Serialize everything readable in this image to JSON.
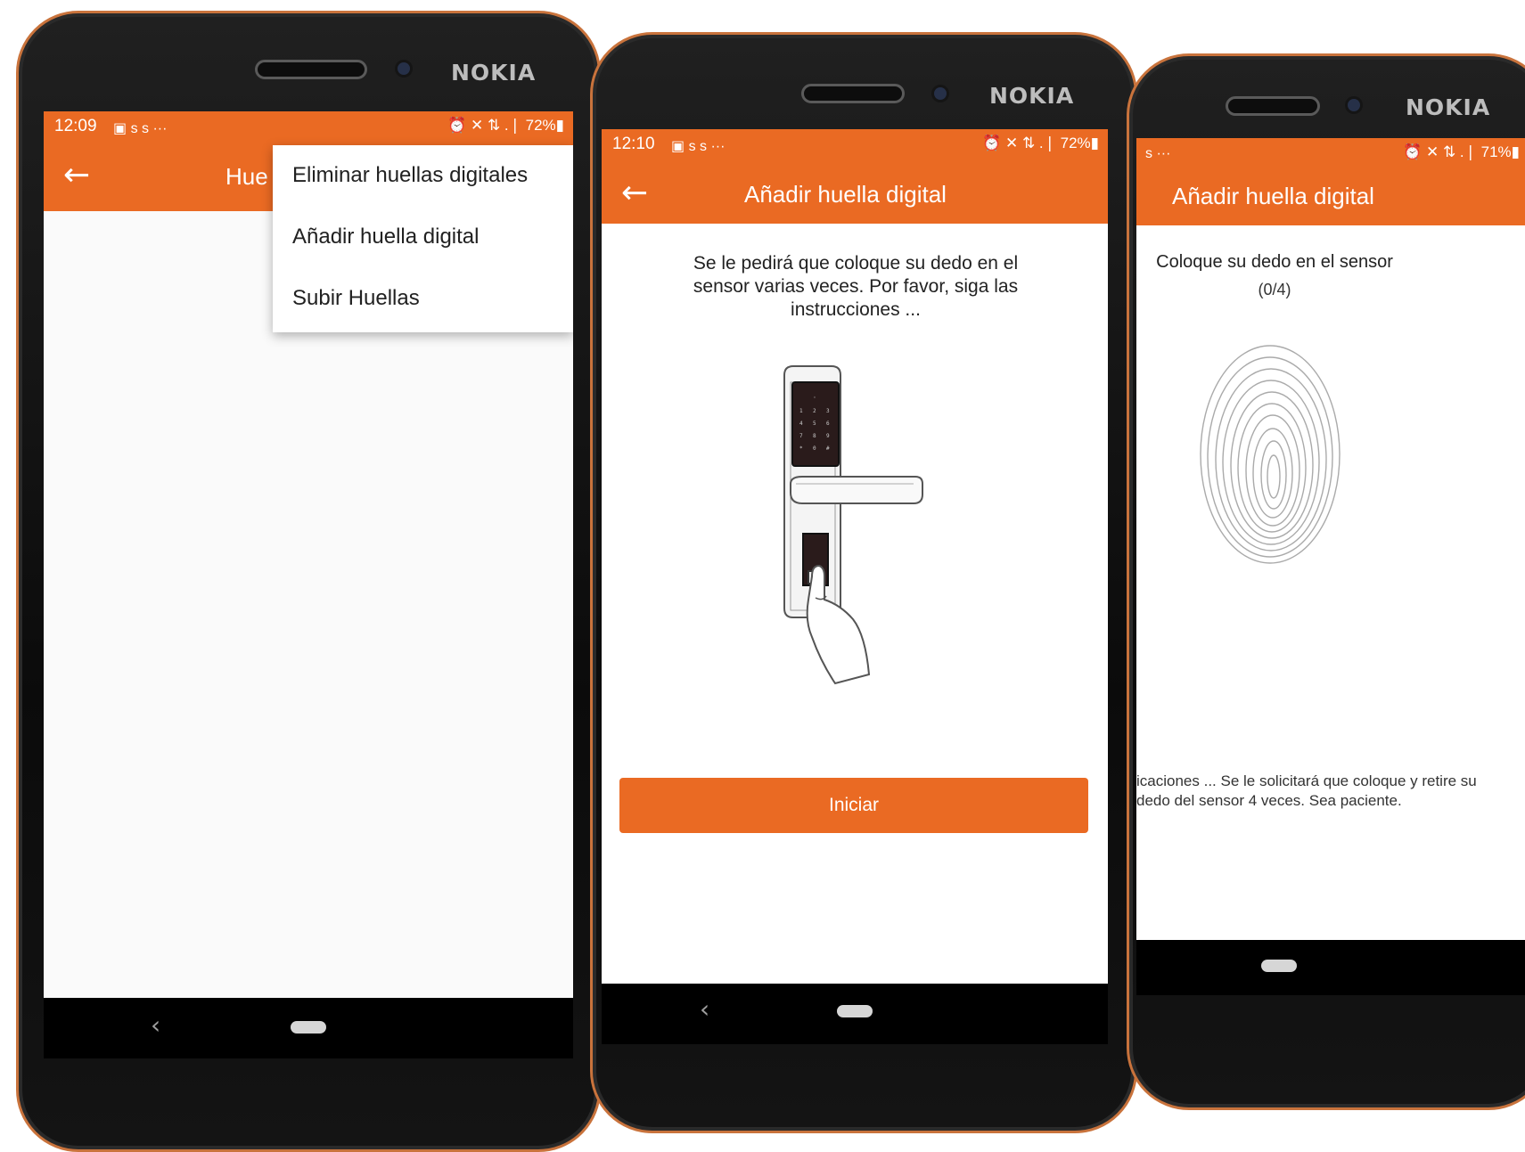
{
  "accent_color": "#ea6a23",
  "phones": {
    "p1": {
      "brand": "NOKIA",
      "status": {
        "time": "12:09",
        "left_icons": "▣  s  s  ···",
        "right_icons": "⏰ ✕ ⇅ .❘ 72%▮"
      },
      "appbar": {
        "title": "Hue"
      },
      "menu": [
        "Eliminar huellas digitales",
        "Añadir huella digital",
        "Subir Huellas"
      ]
    },
    "p2": {
      "brand": "NOKIA",
      "status": {
        "time": "12:10",
        "left_icons": "▣  s  s  ···",
        "right_icons": "⏰ ✕ ⇅ .❘ 72%▮"
      },
      "appbar": {
        "title": "Añadir huella digital"
      },
      "instructions": "Se le pedirá que coloque su dedo en el sensor varias veces. Por favor, siga las instrucciones ...",
      "start_button": "Iniciar"
    },
    "p3": {
      "brand": "NOKIA",
      "status": {
        "left_icons": "s  ···",
        "right_icons": "⏰ ✕ ⇅ .❘ 71%▮"
      },
      "appbar": {
        "title": "Añadir huella digital"
      },
      "prompt": "Coloque su dedo en el sensor",
      "progress": "(0/4)",
      "hint_line1": "icaciones ... Se le solicitará que coloque y retire su",
      "hint_line2": "dedo del sensor 4 veces. Sea paciente."
    }
  }
}
